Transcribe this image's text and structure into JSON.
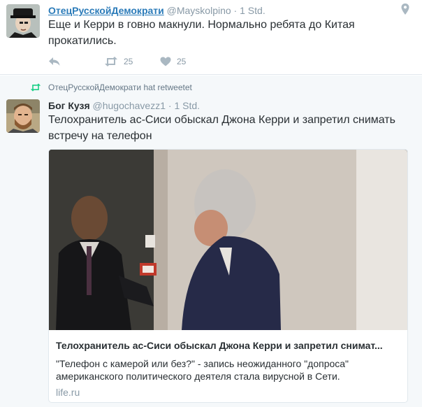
{
  "tweet1": {
    "author_name": "ОтецРусскойДемократи",
    "author_handle": "@Mayskolpino",
    "separator": " · ",
    "time": "1 Std.",
    "text_line1": "Еще и Керри в говно макнули. Нормально ребята до Китая",
    "text_line2": "прокатились.",
    "retweet_count": "25",
    "like_count": "25",
    "icons": {
      "location": "location-pin-icon",
      "reply": "reply-icon",
      "retweet": "retweet-icon",
      "like": "heart-icon"
    }
  },
  "retweet_context": {
    "text": "ОтецРусскойДемократи hat retweetet",
    "icon": "retweet-icon",
    "icon_color": "#19cf86"
  },
  "tweet2": {
    "author_name": "Бог Кузя",
    "author_handle": "@hugochavezz1",
    "separator": " · ",
    "time": "1 Std.",
    "text_line1": "Телохранитель ас-Сиси обыскал Джона Керри и запретил снимать",
    "text_line2": "встречу на телефон",
    "card": {
      "title": "Телохранитель ас-Сиси обыскал Джона Керри и запретил снимат...",
      "description": "\"Телефон с камерой или без?\" - запись неожиданного \"допроса\" американского политического деятеля стала вирусной в Сети.",
      "domain": "life.ru"
    }
  },
  "colors": {
    "link": "#2b7bb9",
    "text": "#292f33",
    "muted": "#8899a6",
    "border": "#e1e8ed",
    "retweet_green": "#19cf86"
  }
}
